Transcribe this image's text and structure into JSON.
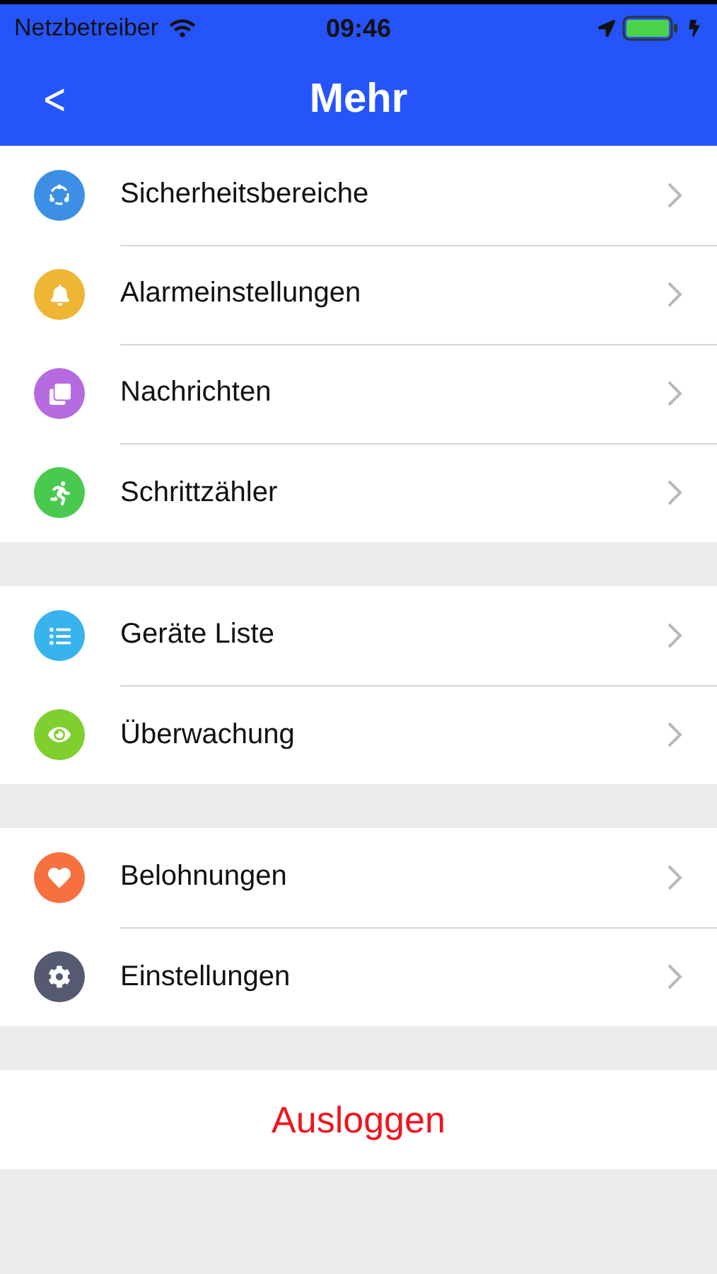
{
  "status_bar": {
    "carrier": "Netzbetreiber",
    "time": "09:46"
  },
  "nav": {
    "back": "<",
    "title": "Mehr"
  },
  "groups": [
    {
      "items": [
        {
          "label": "Sicherheitsbereiche",
          "kind": "ring",
          "color": "#3d8fe6"
        },
        {
          "label": "Alarmeinstellungen",
          "kind": "bell",
          "color": "#efb534"
        },
        {
          "label": "Nachrichten",
          "kind": "squares",
          "color": "#b66ae0"
        },
        {
          "label": "Schrittzähler",
          "kind": "runner",
          "color": "#4ac94f"
        }
      ]
    },
    {
      "items": [
        {
          "label": "Geräte Liste",
          "kind": "list",
          "color": "#37b3ee"
        },
        {
          "label": "Überwachung",
          "kind": "eye",
          "color": "#7fcf2f"
        }
      ]
    },
    {
      "items": [
        {
          "label": "Belohnungen",
          "kind": "hearts",
          "color": "#f7703f"
        },
        {
          "label": "Einstellungen",
          "kind": "gear",
          "color": "#555a70"
        }
      ]
    }
  ],
  "logout": "Ausloggen"
}
